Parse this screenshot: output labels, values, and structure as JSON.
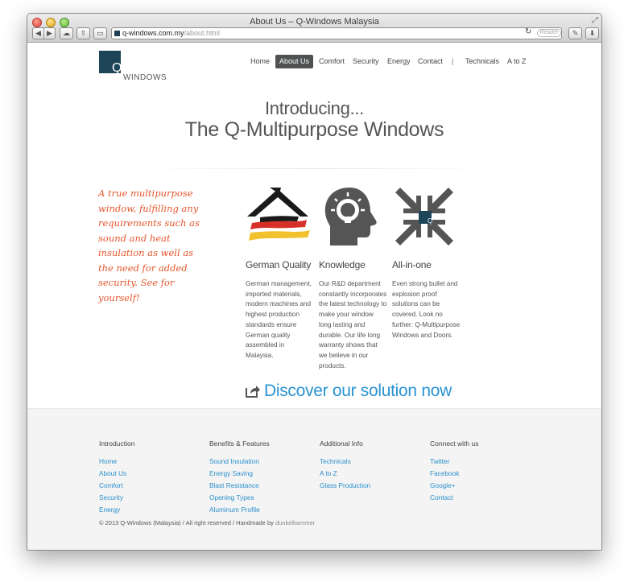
{
  "browser": {
    "window_title": "About Us – Q-Windows Malaysia",
    "url_host": "q-windows.com.my",
    "url_path": "/about.html",
    "reader_label": "Reader"
  },
  "logo": {
    "letter": "Q",
    "text": "WINDOWS"
  },
  "nav": {
    "items": [
      "Home",
      "About Us",
      "Comfort",
      "Security",
      "Energy",
      "Contact"
    ],
    "separator": "|",
    "extra": [
      "Technicals",
      "A to Z"
    ],
    "active": "About Us"
  },
  "hero": {
    "intro": "Introducing...",
    "title": "The Q-Multipurpose Windows"
  },
  "tagline": "A true multipurpose window, fulfilling any requirements such as sound and heat insulation as well as the need for added security. See for yourself!",
  "features": [
    {
      "title": "German Quality",
      "text": "German management, imported materials, modern machines and highest production standards ensure German quality assembled in Malaysia.",
      "icon": "german-flag-house-icon"
    },
    {
      "title": "Knowledge",
      "text": "Our R&D department constantly incorporates the latest technology to make your window long lasting and durable. Our life long warranty shows that we believe in our products.",
      "icon": "head-lightbulb-icon"
    },
    {
      "title": "All-in-one",
      "text": "Even strong bullet and explosion proof solutions can be covered. Look no further: Q-Multipurpose Windows and Doors.",
      "icon": "arrows-converge-icon"
    }
  ],
  "cta": {
    "label": "Discover our solution now"
  },
  "footer": {
    "columns": [
      {
        "heading": "Introduction",
        "links": [
          "Home",
          "About Us",
          "Comfort",
          "Security",
          "Energy"
        ]
      },
      {
        "heading": "Benefits & Features",
        "links": [
          "Sound Insulation",
          "Energy Saving",
          "Blast Resistance",
          "Opening Types",
          "Aluminum Profile"
        ]
      },
      {
        "heading": "Additional Info",
        "links": [
          "Technicals",
          "A to Z",
          "Glass Production"
        ]
      },
      {
        "heading": "Connect with us",
        "links": [
          "Twitter",
          "Facebook",
          "Google+",
          "Contact"
        ]
      }
    ],
    "copyright": "© 2013 Q-Windows (Malaysia) / All right reserved / Handmade by",
    "maker": "dunkelkammer"
  },
  "colors": {
    "accent_link": "#2a93d2",
    "tagline": "#e4562c",
    "logo": "#1d4457",
    "nav_active_bg": "#4f5152"
  }
}
